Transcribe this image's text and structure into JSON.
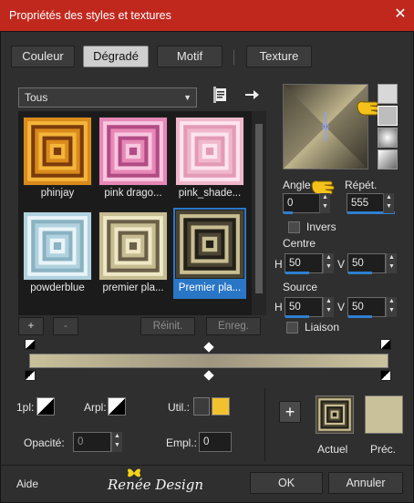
{
  "window": {
    "title": "Propriétés des styles et textures",
    "close_glyph": "✕"
  },
  "tabs": [
    {
      "label": "Couleur"
    },
    {
      "label": "Dégradé"
    },
    {
      "label": "Motif"
    },
    {
      "label": "Texture"
    }
  ],
  "gallery": {
    "filter": "Tous",
    "items": [
      {
        "caption": "phinjay",
        "colors": [
          "#d98a1b",
          "#f4b53a",
          "#7a3b0c"
        ]
      },
      {
        "caption": "pink drago...",
        "colors": [
          "#e888b6",
          "#f7c6df",
          "#b24b85"
        ]
      },
      {
        "caption": "pink_shade...",
        "colors": [
          "#f0b8cb",
          "#fde4ee",
          "#e49ab5"
        ]
      },
      {
        "caption": "powderblue",
        "colors": [
          "#b0d2de",
          "#e9f4f8",
          "#8ab2c2"
        ]
      },
      {
        "caption": "premier pla...",
        "colors": [
          "#c7bd93",
          "#efe8c6",
          "#6a6048"
        ]
      },
      {
        "caption": "Premier pla...",
        "colors": [
          "#4b4534",
          "#c9be92",
          "#23201a"
        ]
      }
    ]
  },
  "buttons": {
    "add": "+",
    "remove": "-",
    "reset": "Réinit.",
    "save": "Enreg."
  },
  "gradient": {
    "angle_label": "Angle",
    "angle_value": "0",
    "repeat_label": "Répét.",
    "repeat_value": "555",
    "invert_label": "Invers",
    "center_label": "Centre",
    "center_h": "50",
    "center_v": "50",
    "source_label": "Source",
    "source_h": "50",
    "source_v": "50",
    "link_label": "Liaison",
    "h_label": "H",
    "v_label": "V"
  },
  "stops": {
    "first_label": "1pl:",
    "back_label": "Arpl:",
    "user_label": "Util.:",
    "user_color": "#f2c12e",
    "opacity_label": "Opacité:",
    "opacity_value": "0",
    "location_label": "Empl.:",
    "location_value": "0"
  },
  "swatches": {
    "add_glyph": "+",
    "current_label": "Actuel",
    "previous_label": "Préc.",
    "previous_color": "#c9c19a"
  },
  "footer": {
    "help": "Aide",
    "watermark": "Renée Design",
    "ok": "OK",
    "cancel": "Annuler"
  },
  "colors": {
    "title_bar": "#c0281e",
    "accent": "#2a76c6"
  }
}
